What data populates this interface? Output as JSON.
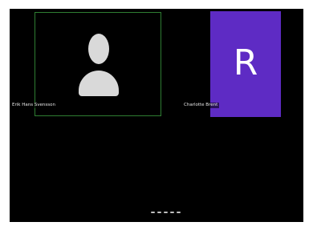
{
  "participants": {
    "self": {
      "name": "Erik Hans Svensson",
      "avatar": "person-silhouette-icon",
      "border_color": "#2e7d32"
    },
    "other": {
      "name": "Charlotte Brent",
      "initial": "R",
      "tile_color": "#5e2bc4"
    }
  },
  "pager": {
    "dots": 5,
    "active_index": 0
  },
  "colors": {
    "background": "#000000",
    "silhouette": "#d9d9d9"
  }
}
